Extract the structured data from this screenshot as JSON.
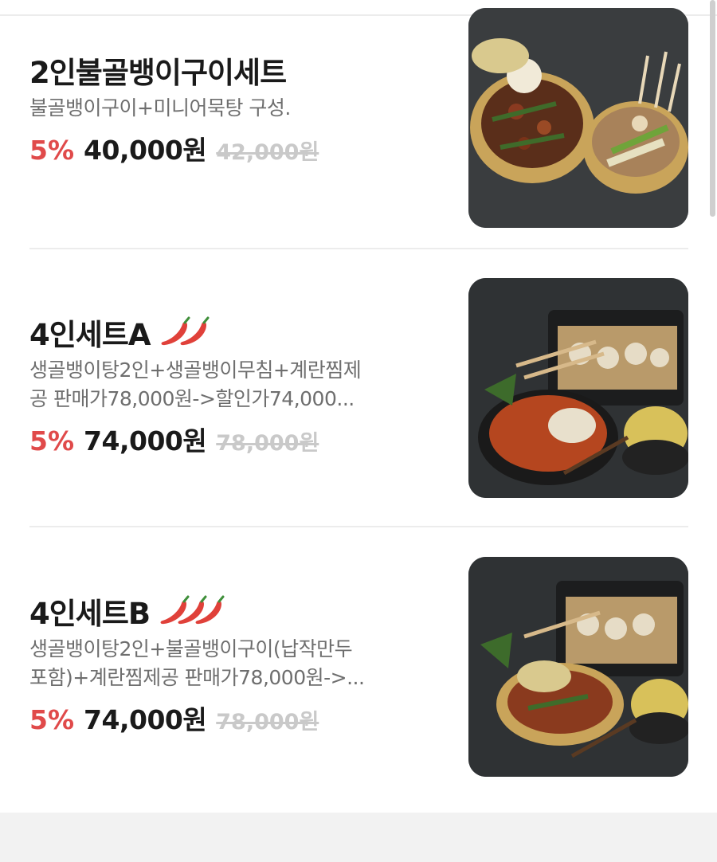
{
  "menu_items": [
    {
      "title": "2인불골뱅이구이세트",
      "description": "불골뱅이구이+미니어묵탕 구성.",
      "discount": "5%",
      "price": "40,000원",
      "original_price": "42,000원",
      "spicy_level": 0,
      "image_icon": "food-photo-icon"
    },
    {
      "title": "4인세트A",
      "description_line1": "생골뱅이탕2인+생골뱅이무침+계란찜제",
      "description_line2": "공 판매가78,000원->할인가74,000...",
      "discount": "5%",
      "price": "74,000원",
      "original_price": "78,000원",
      "spicy_level": 2,
      "image_icon": "food-photo-icon"
    },
    {
      "title": "4인세트B",
      "description_line1": "생골뱅이탕2인+불골뱅이구이(납작만두",
      "description_line2": "포함)+계란찜제공 판매가78,000원->...",
      "discount": "5%",
      "price": "74,000원",
      "original_price": "78,000원",
      "spicy_level": 3,
      "image_icon": "food-photo-icon"
    }
  ],
  "colors": {
    "discount": "#e04a4a",
    "pepper": "#e0413a",
    "strikethrough": "#c9c9c9"
  }
}
